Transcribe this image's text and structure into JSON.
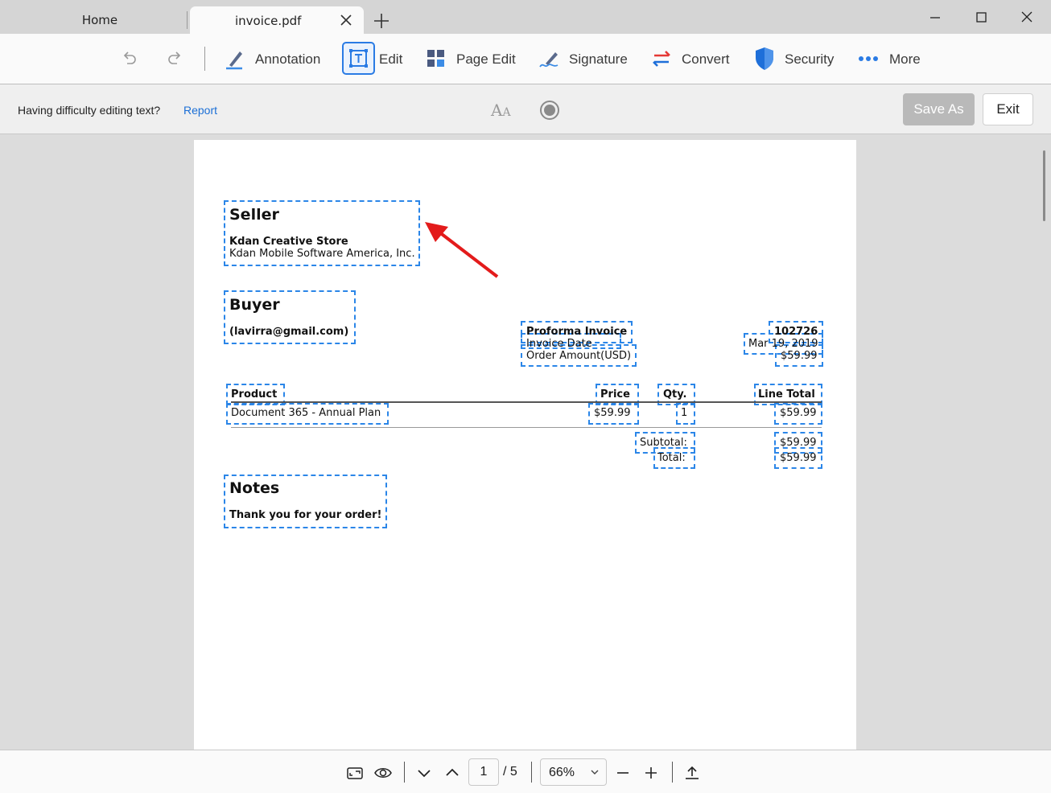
{
  "tabs": {
    "home": "Home",
    "active": "invoice.pdf"
  },
  "toolbar": {
    "annotation": "Annotation",
    "edit": "Edit",
    "page_edit": "Page Edit",
    "signature": "Signature",
    "convert": "Convert",
    "security": "Security",
    "more": "More"
  },
  "hintbar": {
    "message": "Having difficulty editing text?",
    "link": "Report",
    "font_icon_big": "A",
    "font_icon_small": "A",
    "save_as": "Save As",
    "exit": "Exit"
  },
  "invoice": {
    "seller_title": "Seller",
    "seller_name": "Kdan Creative Store",
    "seller_company": "Kdan Mobile Software America, Inc.",
    "buyer_title": "Buyer",
    "buyer_email": "(lavirra@gmail.com)",
    "proforma_label": "Proforma Invoice",
    "invoice_date_label": "Invoice Date",
    "order_amount_label": "Order Amount(USD)",
    "invoice_number": "102726",
    "invoice_date": "Mar 19, 2019",
    "order_amount": "$59.99",
    "col_product": "Product",
    "col_price": "Price",
    "col_qty": "Qty.",
    "col_line_total": "Line Total",
    "row_product": "Document 365 - Annual Plan",
    "row_price": "$59.99",
    "row_qty": "1",
    "row_line_total": "$59.99",
    "subtotal_label": "Subtotal:",
    "subtotal_value": "$59.99",
    "total_label": "Total:",
    "total_value": "$59.99",
    "notes_title": "Notes",
    "notes_text": "Thank you for your order!"
  },
  "footer": {
    "current_page": "1",
    "page_total": "/ 5",
    "zoom": "66%"
  },
  "colors": {
    "accent": "#2a7be4",
    "textbox_border": "#2b86e8",
    "arrow": "#e31b1b",
    "convert_red": "#e53935",
    "convert_blue": "#1e6fd9"
  }
}
